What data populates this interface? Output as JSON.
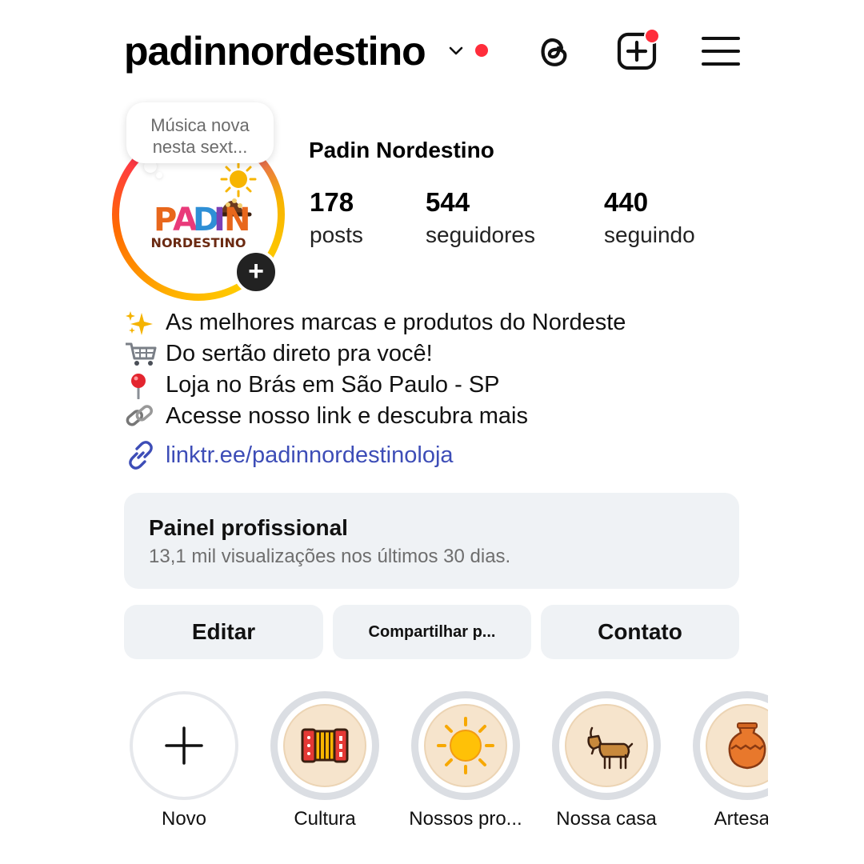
{
  "header": {
    "username": "padinnordestino",
    "icons": [
      "chevron-down-icon",
      "notification-dot",
      "threads-icon",
      "create-post-icon",
      "hamburger-menu-icon"
    ],
    "accent_dot_color": "#ff2d3b"
  },
  "avatar": {
    "note": "Música nova nesta sext...",
    "logo_text_top": "PADIN",
    "logo_text_bottom": "NORDESTINO",
    "add_story_icon": "+"
  },
  "profile": {
    "display_name": "Padin Nordestino",
    "stats": [
      {
        "value": "178",
        "label": "posts"
      },
      {
        "value": "544",
        "label": "seguidores"
      },
      {
        "value": "440",
        "label": "seguindo"
      }
    ]
  },
  "bio": {
    "lines": [
      {
        "icon": "sparkles-icon",
        "text": "As melhores marcas e produtos do Nordeste"
      },
      {
        "icon": "shopping-cart-icon",
        "text": "Do sertão direto pra você!"
      },
      {
        "icon": "pushpin-icon",
        "text": "Loja no Brás em São Paulo - SP"
      },
      {
        "icon": "chain-link-icon",
        "text": "Acesse nosso link e descubra mais"
      }
    ],
    "link": "linktr.ee/padinnordestinoloja",
    "link_color": "#3d4db7"
  },
  "dashboard": {
    "title": "Painel profissional",
    "subtitle": "13,1 mil visualizações nos últimos 30 dias."
  },
  "buttons": {
    "edit": "Editar",
    "share": "Compartilhar p...",
    "contact": "Contato"
  },
  "highlights": [
    {
      "label": "Novo",
      "icon": "plus-icon"
    },
    {
      "label": "Cultura",
      "icon": "accordion-icon"
    },
    {
      "label": "Nossos pro...",
      "icon": "sun-icon"
    },
    {
      "label": "Nossa casa",
      "icon": "goat-icon"
    },
    {
      "label": "Artesan",
      "icon": "clay-pot-icon"
    }
  ]
}
